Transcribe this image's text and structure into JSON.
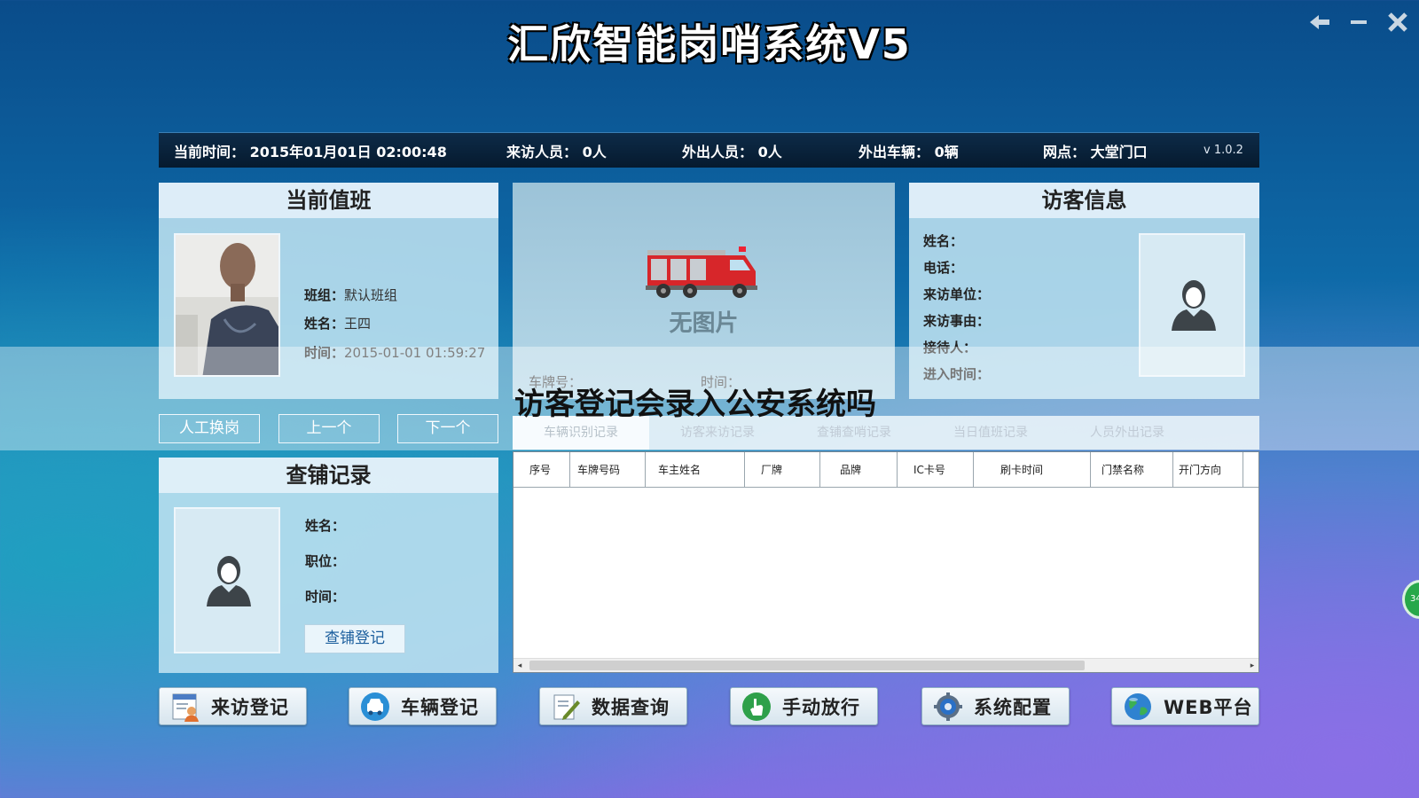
{
  "app": {
    "title": "汇欣智能岗哨系统V5"
  },
  "status_bar": {
    "time_label": "当前时间：",
    "time_value": "2015年01月01日 02:00:48",
    "visitors_label": "来访人员：",
    "visitors_value": "0人",
    "out_people_label": "外出人员：",
    "out_people_value": "0人",
    "out_vehicles_label": "外出车辆：",
    "out_vehicles_value": "0辆",
    "site_label": "网点：",
    "site_value": "大堂门口",
    "version": "v 1.0.2"
  },
  "duty": {
    "title": "当前值班",
    "group_label": "班组：",
    "group_value": "默认班组",
    "name_label": "姓名：",
    "name_value": "王四",
    "time_label": "时间：",
    "time_value": "2015-01-01 01:59:27",
    "btn_manual": "人工换岗",
    "btn_prev": "上一个",
    "btn_next": "下一个"
  },
  "vehicle": {
    "no_image": "无图片",
    "plate_label": "车牌号：",
    "time_label": "时间："
  },
  "visitor": {
    "title": "访客信息",
    "name_label": "姓名：",
    "phone_label": "电话：",
    "unit_label": "来访单位：",
    "reason_label": "来访事由：",
    "host_label": "接待人：",
    "entry_time_label": "进入时间："
  },
  "patrol": {
    "title": "查铺记录",
    "name_label": "姓名：",
    "position_label": "职位：",
    "time_label": "时间：",
    "register_btn": "查铺登记"
  },
  "tabs": [
    "车辆识别记录",
    "访客来访记录",
    "查铺查哨记录",
    "当日值班记录",
    "人员外出记录"
  ],
  "table": {
    "columns": [
      "序号",
      "车牌号码",
      "车主姓名",
      "厂牌",
      "品牌",
      "IC卡号",
      "刷卡时间",
      "门禁名称",
      "开门方向"
    ]
  },
  "bottom_buttons": {
    "visit": "来访登记",
    "vehicle": "车辆登记",
    "query": "数据查询",
    "manual": "手动放行",
    "config": "系统配置",
    "web": "WEB平台"
  },
  "overlay": {
    "text": "访客登记会录入公安系统吗"
  },
  "side_badge": "34"
}
